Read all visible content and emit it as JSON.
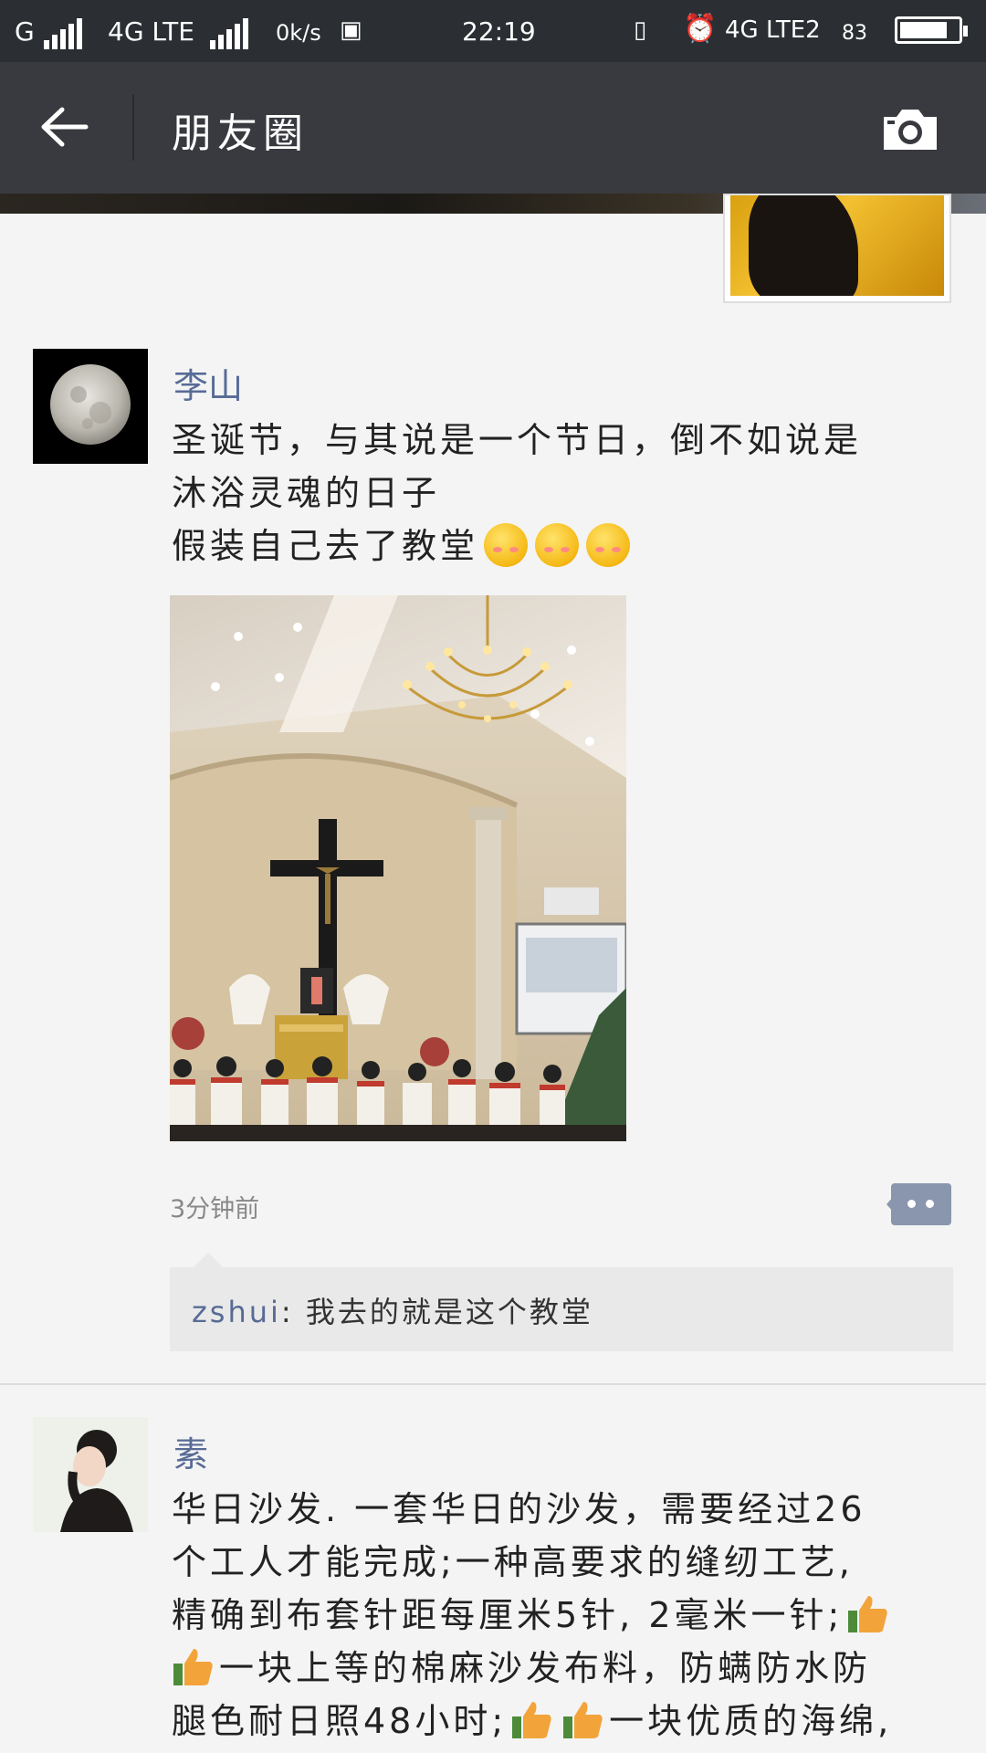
{
  "status_bar": {
    "carrier1": "G",
    "carrier2": "4G LTE",
    "speed": "0k/s",
    "time": "22:19",
    "network": "4G LTE2",
    "battery": "83",
    "battery_level": 0.83
  },
  "header": {
    "title": "朋友圈"
  },
  "posts": [
    {
      "name": "李山",
      "lines": [
        "圣诞节，与其说是一个节日，倒不如说是",
        "沐浴灵魂的日子",
        "假装自己去了教堂"
      ],
      "emoji_count": 3,
      "timestamp": "3分钟前",
      "comment": {
        "user": "zshui",
        "separator": ": ",
        "text": "我去的就是这个教堂"
      }
    },
    {
      "name": "素",
      "lines": [
        "华日沙发. 一套华日的沙发，需要经过26",
        "个工人才能完成;一种高要求的缝纫工艺,",
        "精确到布套针距每厘米5针, 2毫米一针;",
        "一块上等的棉麻沙发布料，防螨防水防",
        "腿色耐日照48小时;",
        "一块优质的海绵,"
      ]
    }
  ],
  "colors": {
    "name": "#576b95",
    "title_bar": "#393a3f",
    "status_bar": "#2b2f33"
  }
}
